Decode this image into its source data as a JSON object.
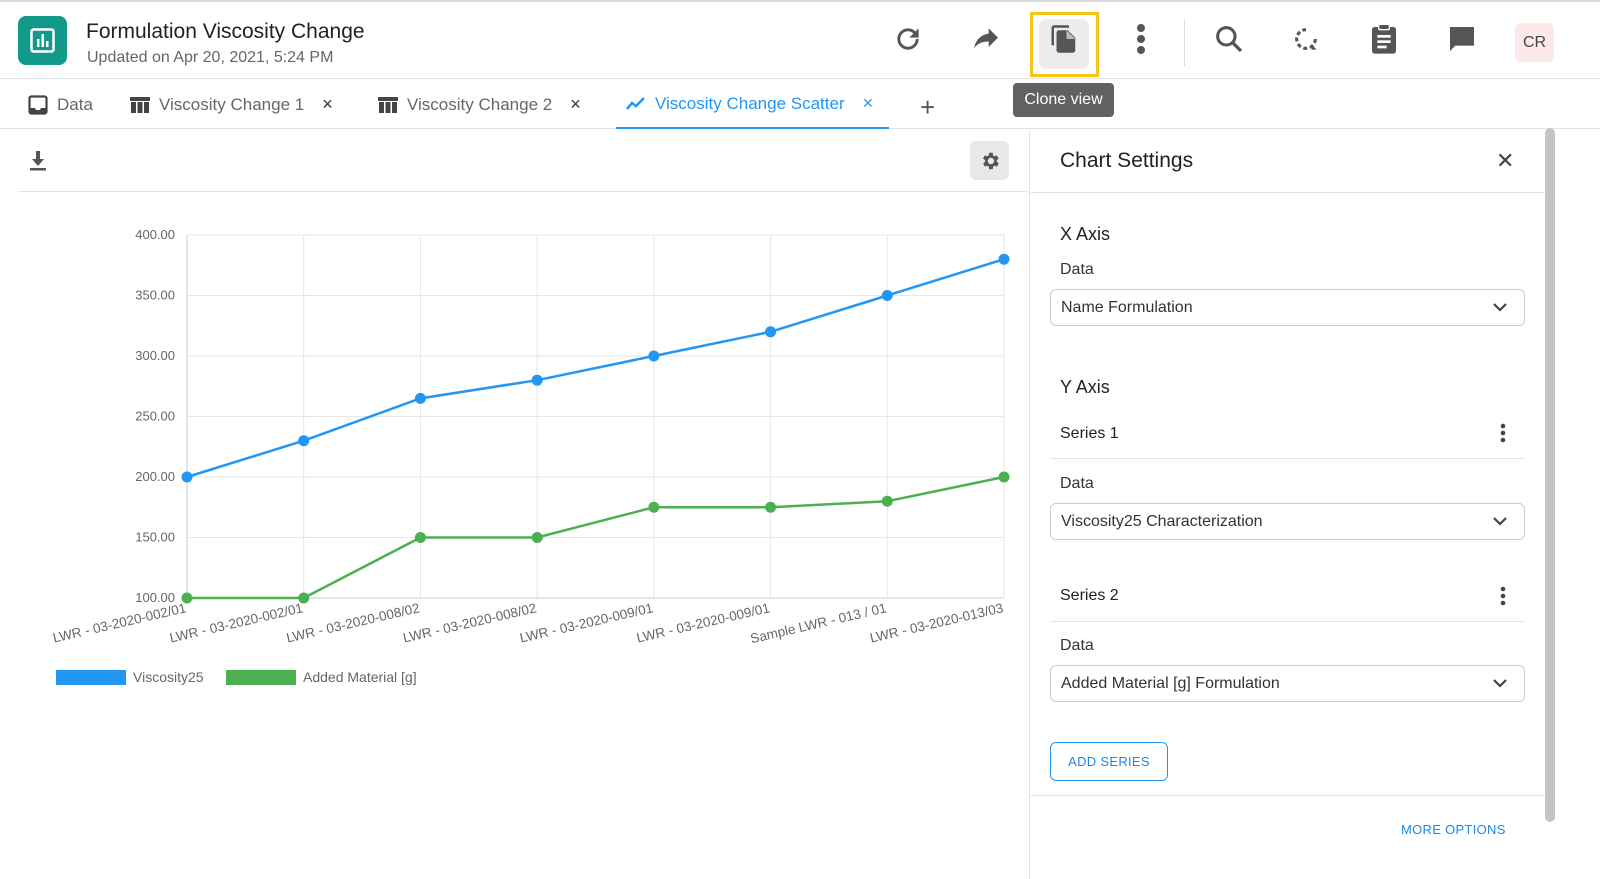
{
  "header": {
    "title": "Formulation Viscosity Change",
    "subtitle": "Updated on Apr 20, 2021, 5:24 PM",
    "avatar": "CR",
    "tooltip": "Clone view"
  },
  "tabs": [
    {
      "label": "Data"
    },
    {
      "label": "Viscosity Change 1",
      "close": "×"
    },
    {
      "label": "Viscosity Change 2",
      "close": "×"
    },
    {
      "label": "Viscosity Change Scatter",
      "close": "×"
    }
  ],
  "add_tab": "+",
  "panel": {
    "title": "Chart Settings",
    "close": "✕",
    "x_axis": "X Axis",
    "data_label": "Data",
    "x_data": "Name Formulation",
    "y_axis": "Y Axis",
    "series1": "Series 1",
    "series1_data": "Viscosity25 Characterization",
    "series2": "Series 2",
    "series2_data": "Added Material [g] Formulation",
    "add_series": "ADD SERIES",
    "more_options": "MORE OPTIONS"
  },
  "chart_data": {
    "type": "line",
    "categories": [
      "LWR - 03-2020-002/01",
      "LWR - 03-2020-002/01",
      "LWR - 03-2020-008/02",
      "LWR - 03-2020-008/02",
      "LWR - 03-2020-009/01",
      "LWR - 03-2020-009/01",
      "Sample LWR - 013 / 01",
      "LWR - 03-2020-013/03"
    ],
    "series": [
      {
        "name": "Viscosity25",
        "color": "#2196f3",
        "values": [
          200,
          230,
          265,
          280,
          300,
          320,
          350,
          380
        ]
      },
      {
        "name": "Added Material [g]",
        "color": "#4caf50",
        "values": [
          100,
          100,
          150,
          150,
          175,
          175,
          180,
          200
        ]
      }
    ],
    "yticks": [
      "100.00",
      "150.00",
      "200.00",
      "250.00",
      "300.00",
      "350.00",
      "400.00"
    ],
    "ylim": [
      100,
      400
    ],
    "grid": true,
    "legend": "bottom-left"
  }
}
